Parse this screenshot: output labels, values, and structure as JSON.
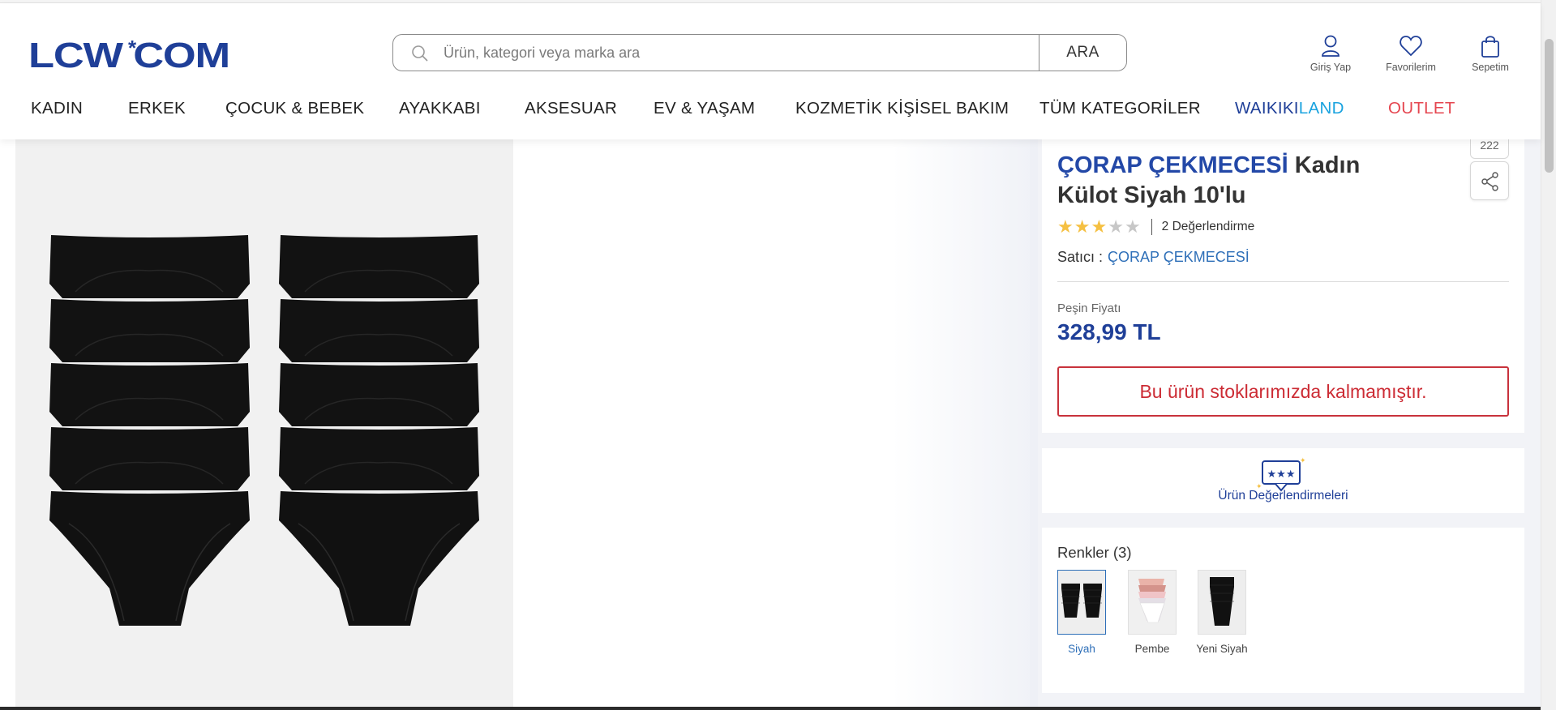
{
  "header": {
    "logo_text": "LCW*COM",
    "search": {
      "placeholder": "Ürün, kategori veya marka ara",
      "button_label": "ARA"
    },
    "login_label": "Giriş Yap",
    "favorites_label": "Favorilerim",
    "cart_label": "Sepetim"
  },
  "nav": {
    "items": [
      "KADIN",
      "ERKEK",
      "ÇOCUK & BEBEK",
      "AYAKKABI",
      "AKSESUAR",
      "EV & YAŞAM",
      "KOZMETİK KİŞİSEL BAKIM",
      "TÜM KATEGORİLER"
    ],
    "waikiki_part1": "WAIKIKI",
    "waikiki_part2": "LAND",
    "outlet": "OUTLET"
  },
  "product": {
    "brand": "ÇORAP ÇEKMECESİ",
    "name": " Kadın Külot Siyah 10'lu",
    "counter": "222",
    "rating": 3,
    "rating_max": 5,
    "review_count_label": "2 Değerlendirme",
    "seller_label": "Satıcı :",
    "seller_name": "ÇORAP ÇEKMECESİ",
    "price_label": "Peşin Fiyatı",
    "price": "328,99 TL",
    "stock_message": "Bu ürün stoklarımızda kalmamıştır."
  },
  "reviews": {
    "label": "Ürün Değerlendirmeleri"
  },
  "colors": {
    "title": "Renkler (3)",
    "options": [
      {
        "label": "Siyah",
        "selected": true
      },
      {
        "label": "Pembe",
        "selected": false
      },
      {
        "label": "Yeni Siyah",
        "selected": false
      }
    ]
  },
  "theme": {
    "brand_blue": "#1f3f98",
    "link_blue": "#2e6fb8",
    "outlet_red": "#e5454f",
    "land_cyan": "#1aa3df",
    "alert_red": "#c8323c",
    "star_yellow": "#f5c042"
  }
}
